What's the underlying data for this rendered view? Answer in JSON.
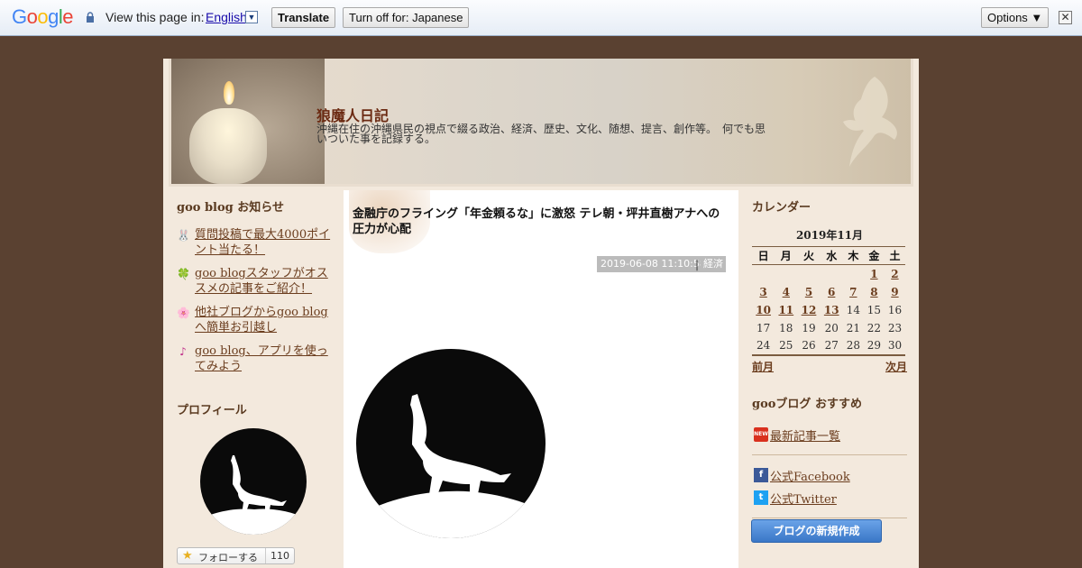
{
  "translate_bar": {
    "logo": "Google",
    "view_label": "View this page in:",
    "language": "English",
    "dropdown_glyph": "▼",
    "translate_button": "Translate",
    "turn_off_button": "Turn off for: Japanese",
    "options_button": "Options ▼",
    "close_glyph": "✕"
  },
  "blog": {
    "title": "狼魔人日記",
    "description": "沖縄在住の沖縄県民の視点で綴る政治、経済、歴史、文化、随想、提言、創作等。　何でも思いついた事を記録する。"
  },
  "news": {
    "heading": "goo blog お知らせ",
    "items": [
      {
        "icon": "rabbit-icon",
        "glyph": "🐰",
        "label": "質問投稿で最大4000ポイント当たる！"
      },
      {
        "icon": "clover-icon",
        "glyph": "🍀",
        "label": "goo blogスタッフがオススメの記事をご紹介！"
      },
      {
        "icon": "flower-icon",
        "glyph": "🌸",
        "label": "他社ブログからgoo blogへ簡単お引越し"
      },
      {
        "icon": "music-note-icon",
        "glyph": "♪",
        "label": "goo blog、アプリを使ってみよう"
      }
    ]
  },
  "profile": {
    "heading": "プロフィール",
    "follow_label": "フォローする",
    "follow_count": "110"
  },
  "post": {
    "title": "金融庁のフライング「年金頼るな」に激怒 テレ朝・坪井直樹アナへの圧力が心配",
    "date": "2019-06-08 11:10:58",
    "separator": "|",
    "category": "経済"
  },
  "calendar": {
    "heading": "カレンダー",
    "month": "2019年11月",
    "weekdays": [
      "日",
      "月",
      "火",
      "水",
      "木",
      "金",
      "土"
    ],
    "weeks": [
      [
        "",
        "",
        "",
        "",
        "",
        "1",
        "2"
      ],
      [
        "3",
        "4",
        "5",
        "6",
        "7",
        "8",
        "9"
      ],
      [
        "10",
        "11",
        "12",
        "13",
        "14",
        "15",
        "16"
      ],
      [
        "17",
        "18",
        "19",
        "20",
        "21",
        "22",
        "23"
      ],
      [
        "24",
        "25",
        "26",
        "27",
        "28",
        "29",
        "30"
      ]
    ],
    "linked_days": [
      "1",
      "2",
      "3",
      "4",
      "5",
      "6",
      "7",
      "8",
      "9",
      "10",
      "11",
      "12",
      "13"
    ],
    "prev": "前月",
    "next": "次月"
  },
  "recommend": {
    "heading": "gooブログ おすすめ",
    "latest": "最新記事一覧",
    "new_badge": "NEW",
    "facebook": "公式Facebook",
    "facebook_glyph": "f",
    "twitter": "公式Twitter",
    "twitter_glyph": "t",
    "new_blog_button": "ブログの新規作成"
  },
  "colors": {
    "page_bg": "#5a4131",
    "column_bg": "#f3e9dd",
    "link": "#6b3d1e",
    "title": "#6b2a12",
    "facebook": "#3b5998",
    "twitter": "#1da1f2",
    "new_badge": "#d9301e"
  }
}
